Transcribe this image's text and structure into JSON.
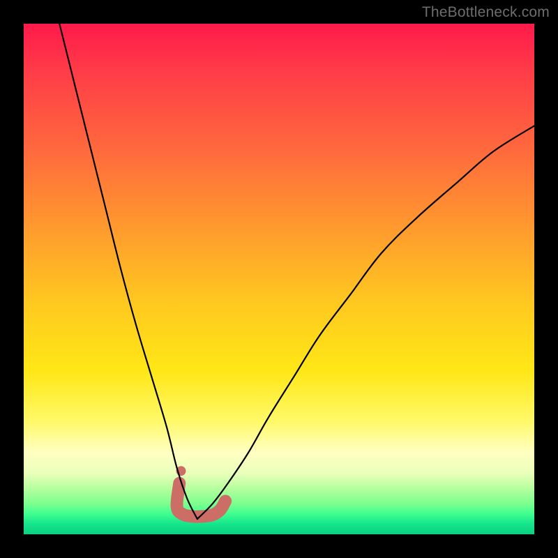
{
  "watermark": {
    "text": "TheBottleneck.com"
  },
  "colors": {
    "frame": "#000000",
    "curve": "#000000",
    "blob": "#cc6e66",
    "watermark": "#6d6d6d"
  },
  "chart_data": {
    "type": "line",
    "title": "",
    "xlabel": "",
    "ylabel": "",
    "xlim": [
      0,
      100
    ],
    "ylim": [
      0,
      100
    ],
    "note": "x in percent of plot width (0=left), y in percent of plot height (0=bottom). Two curve arms meeting near x≈34 at y≈3.",
    "series": [
      {
        "name": "left-arm",
        "x": [
          7,
          10,
          13,
          16,
          19,
          22,
          25,
          28,
          30,
          32,
          34
        ],
        "y": [
          100,
          88,
          76,
          64,
          52,
          41,
          31,
          21,
          13,
          7,
          3
        ]
      },
      {
        "name": "right-arm",
        "x": [
          34,
          37,
          40,
          44,
          48,
          53,
          58,
          64,
          70,
          77,
          85,
          92,
          100
        ],
        "y": [
          3,
          6,
          10,
          16,
          23,
          31,
          39,
          47,
          55,
          62,
          69,
          75,
          80
        ]
      }
    ],
    "markers": {
      "name": "valley-blob",
      "color": "#cc6e66",
      "points_xy_pct": [
        [
          30.5,
          10.0
        ],
        [
          30.0,
          5.5
        ],
        [
          31.0,
          4.0
        ],
        [
          33.0,
          3.5
        ],
        [
          35.0,
          3.5
        ],
        [
          37.0,
          3.8
        ],
        [
          38.5,
          4.8
        ],
        [
          39.5,
          6.5
        ]
      ],
      "thickness_px": 18
    }
  }
}
